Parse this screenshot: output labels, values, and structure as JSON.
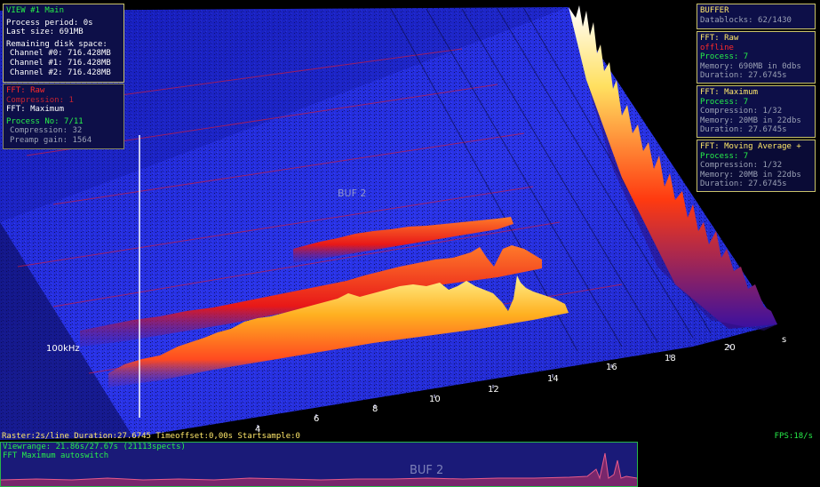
{
  "view_panel": {
    "title": "VIEW #1 Main",
    "process_period": "Process period: 0s",
    "last_size": "Last size: 691MB",
    "remaining_header": "Remaining disk space:",
    "channels": [
      "Channel #0: 716.428MB",
      "Channel #1: 716.428MB",
      "Channel #2: 716.428MB"
    ]
  },
  "fft_left_panel": {
    "raw_label": "FFT: Raw",
    "raw_status": "Compression: 1",
    "title": "FFT: Maximum",
    "process_no": "Process No: 7/11",
    "compression": "Compression: 32",
    "preamp_gain": "Preamp gain: 1564"
  },
  "buffer_panel": {
    "title": "BUFFER",
    "datablocks": "Datablocks: 62/1430"
  },
  "fft_raw_panel": {
    "title": "FFT: Raw",
    "status": "offline",
    "process": "Process: 7",
    "memory": "Memory: 690MB in 0dbs",
    "duration": "Duration: 27.6745s"
  },
  "fft_max_panel": {
    "title": "FFT: Maximum",
    "process": "Process: 7",
    "compression": "Compression: 1/32",
    "memory": "Memory: 20MB in 22dbs",
    "duration": "Duration: 27.6745s"
  },
  "fft_mavg_panel": {
    "title": "FFT: Moving Average +",
    "process": "Process: 7",
    "compression": "Compression: 1/32",
    "memory": "Memory: 20MB in 22dbs",
    "duration": "Duration: 27.6745s"
  },
  "plot": {
    "buffer_label": "BUF 2",
    "freq_label": "100kHz",
    "time_unit": "s",
    "time_ticks": [
      "4",
      "6",
      "8",
      "10",
      "12",
      "14",
      "16",
      "18",
      "20"
    ]
  },
  "status_bar": {
    "left": "Raster:2s/line Duration:27.6745 Timeoffset:0,00s  Startsample:0",
    "fps": "FPS:18/s"
  },
  "bottom_panel": {
    "viewrange": "Viewrange: 21.86s/27.67s (21113spects)",
    "mode": "FFT Maximum  autoswitch",
    "buffer_label": "BUF 2"
  },
  "colors": {
    "panel_bg": "#0d0f48",
    "panel_border": "#c9c26a",
    "text_green": "#27f04a",
    "text_yellow": "#ffe86a",
    "text_red": "#ff2a2a",
    "plane_blue": "#2430e0"
  }
}
